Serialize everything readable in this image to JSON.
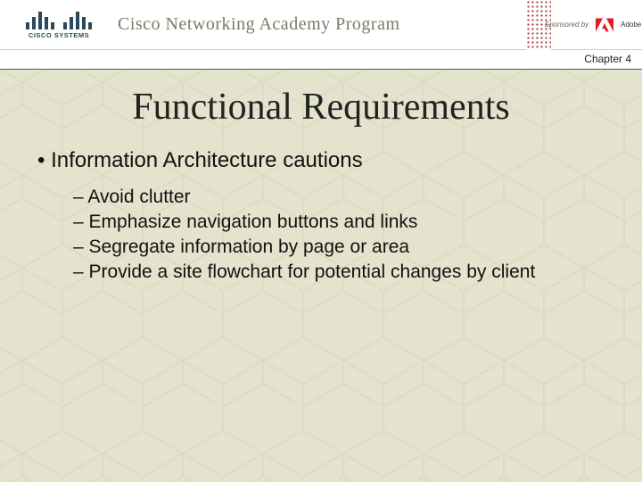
{
  "header": {
    "logo_text": "CISCO SYSTEMS",
    "program_title": "Cisco Networking Academy Program",
    "sponsor_label": "Sponsored by",
    "sponsor_name": "Adobe",
    "chapter": "Chapter 4"
  },
  "slide": {
    "title": "Functional Requirements",
    "bullet": "Information Architecture cautions",
    "sub": [
      "Avoid clutter",
      "Emphasize navigation buttons and links",
      "Segregate information by page or area",
      "Provide a site flowchart for potential changes by client"
    ]
  }
}
